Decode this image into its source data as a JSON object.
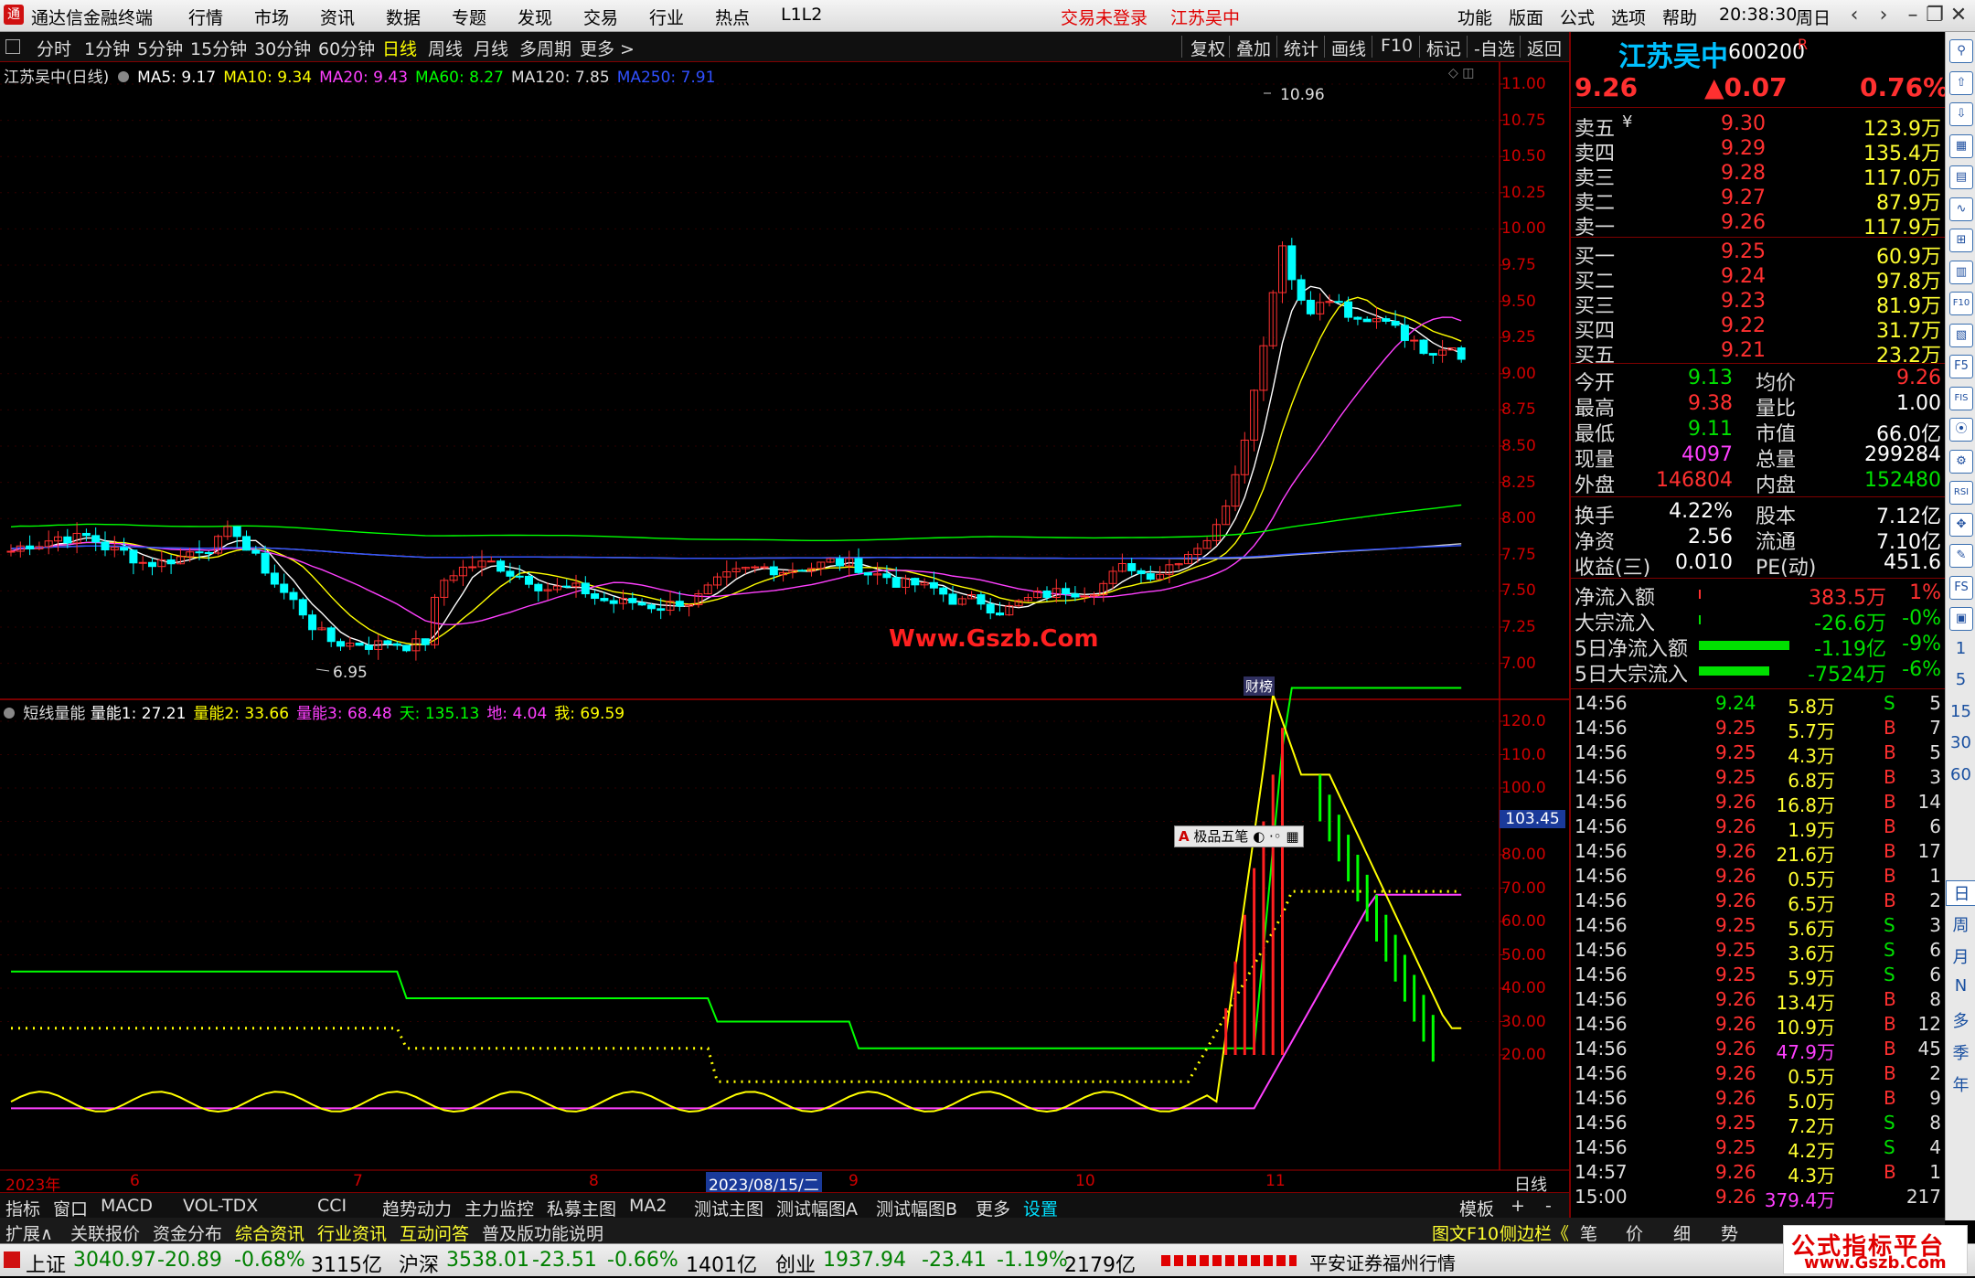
{
  "app": {
    "title": "通达信金融终端",
    "menu": [
      "行情",
      "市场",
      "资讯",
      "数据",
      "专题",
      "发现",
      "交易",
      "行业",
      "热点",
      "L1L2"
    ],
    "login_status": "交易未登录",
    "stock_name_header": "江苏吴中",
    "right_menu": [
      "功能",
      "版面",
      "公式",
      "选项",
      "帮助"
    ],
    "clock": "20:38:30",
    "weekday": "周日"
  },
  "toolbar": {
    "periods": [
      "分时",
      "1分钟",
      "5分钟",
      "15分钟",
      "30分钟",
      "60分钟",
      "日线",
      "周线",
      "月线",
      "多周期",
      "更多 >"
    ],
    "selected": "日线",
    "tools": [
      "复权",
      "叠加",
      "统计",
      "画线",
      "F10",
      "标记",
      "-自选",
      "返回"
    ]
  },
  "main_chart": {
    "title": "江苏吴中(日线)",
    "ma": [
      {
        "label": "MA5: 9.17",
        "color": "#ffffff"
      },
      {
        "label": "MA10: 9.34",
        "color": "#ffff00"
      },
      {
        "label": "MA20: 9.43",
        "color": "#ff40ff"
      },
      {
        "label": "MA60: 8.27",
        "color": "#00ff00"
      },
      {
        "label": "MA120: 7.85",
        "color": "#dddddd"
      },
      {
        "label": "MA250: 7.91",
        "color": "#3050ff"
      }
    ],
    "high_label": "10.96",
    "low_label": "6.95",
    "watermark": "Www.Gszb.Com",
    "caibang": "财榜",
    "y_ticks": [
      "11.00",
      "10.75",
      "10.50",
      "10.25",
      "10.00",
      "9.75",
      "9.50",
      "9.25",
      "9.00",
      "8.75",
      "8.50",
      "8.25",
      "8.00",
      "7.75",
      "7.50",
      "7.25",
      "7.00"
    ]
  },
  "indicator": {
    "name": "短线量能",
    "values": [
      {
        "label": "量能1: 27.21",
        "color": "#ffffff"
      },
      {
        "label": "量能2: 33.66",
        "color": "#ffff00"
      },
      {
        "label": "量能3: 68.48",
        "color": "#ff40ff"
      },
      {
        "label": "天: 135.13",
        "color": "#00ff00"
      },
      {
        "label": "地: 4.04",
        "color": "#ff40ff"
      },
      {
        "label": "我: 69.59",
        "color": "#ffff00"
      }
    ],
    "y_ticks": [
      "120.0",
      "110.0",
      "100.0",
      "90.00",
      "80.00",
      "70.00",
      "60.00",
      "50.00",
      "40.00",
      "30.00",
      "20.00"
    ],
    "current_value": "103.45",
    "popup": "极品五笔"
  },
  "x_axis": {
    "labels": [
      "2023年",
      "6",
      "7",
      "8",
      "2023/08/15/二",
      "9",
      "10",
      "11"
    ],
    "period": "日线"
  },
  "tabs_row1": [
    "指标",
    "窗口",
    "MACD",
    "VOL-TDX",
    "CCI",
    "趋势动力",
    "主力监控",
    "私募主图",
    "MA2",
    "测试主图",
    "测试幅图A",
    "测试幅图B",
    "更多",
    "设置"
  ],
  "tabs_row1_right": [
    "模板",
    "+",
    "-"
  ],
  "tabs_row2": [
    "扩展∧",
    "关联报价",
    "资金分布",
    "综合资讯",
    "行业资讯",
    "互动问答",
    "普及版功能说明"
  ],
  "right_panel": {
    "name": "江苏吴中",
    "code": "600200",
    "r_mark": "R",
    "price": "9.26",
    "change": "▲0.07",
    "change_pct": "0.76%",
    "asks": [
      {
        "label": "卖五",
        "price": "9.30",
        "vol": "123.9万"
      },
      {
        "label": "卖四",
        "price": "9.29",
        "vol": "135.4万"
      },
      {
        "label": "卖三",
        "price": "9.28",
        "vol": "117.0万"
      },
      {
        "label": "卖二",
        "price": "9.27",
        "vol": "87.9万"
      },
      {
        "label": "卖一",
        "price": "9.26",
        "vol": "117.9万"
      }
    ],
    "ask_mark": "¥",
    "bids": [
      {
        "label": "买一",
        "price": "9.25",
        "vol": "60.9万"
      },
      {
        "label": "买二",
        "price": "9.24",
        "vol": "97.8万"
      },
      {
        "label": "买三",
        "price": "9.23",
        "vol": "81.9万"
      },
      {
        "label": "买四",
        "price": "9.22",
        "vol": "31.7万"
      },
      {
        "label": "买五",
        "price": "9.21",
        "vol": "23.2万"
      }
    ],
    "stats": [
      {
        "l1": "今开",
        "v1": "9.13",
        "c1": "grn",
        "l2": "均价",
        "v2": "9.26",
        "c2": "red"
      },
      {
        "l1": "最高",
        "v1": "9.38",
        "c1": "red",
        "l2": "量比",
        "v2": "1.00",
        "c2": "wht"
      },
      {
        "l1": "最低",
        "v1": "9.11",
        "c1": "grn",
        "l2": "市值",
        "v2": "66.0亿",
        "c2": "wht"
      },
      {
        "l1": "现量",
        "v1": "4097",
        "c1": "mag",
        "l2": "总量",
        "v2": "299284",
        "c2": "wht"
      },
      {
        "l1": "外盘",
        "v1": "146804",
        "c1": "red",
        "l2": "内盘",
        "v2": "152480",
        "c2": "grn"
      }
    ],
    "stats2": [
      {
        "l1": "换手",
        "v1": "4.22%",
        "l2": "股本",
        "v2": "7.12亿"
      },
      {
        "l1": "净资",
        "v1": "2.56",
        "l2": "流通",
        "v2": "7.10亿"
      },
      {
        "l1": "收益(三)",
        "v1": "0.010",
        "l2": "PE(动)",
        "v2": "451.6"
      }
    ],
    "flows": [
      {
        "label": "净流入额",
        "value": "383.5万",
        "pct": "1%",
        "color": "red",
        "bar": 0.0
      },
      {
        "label": "大宗流入",
        "value": "-26.6万",
        "pct": "-0%",
        "color": "grn",
        "bar": 0.0
      },
      {
        "label": "5日净流入额",
        "value": "-1.19亿",
        "pct": "-9%",
        "color": "grn",
        "bar": 0.9
      },
      {
        "label": "5日大宗流入",
        "value": "-7524万",
        "pct": "-6%",
        "color": "grn",
        "bar": 0.7
      }
    ],
    "ticks": [
      {
        "t": "14:56",
        "p": "9.24",
        "v": "5.8万",
        "bs": "S",
        "n": "5"
      },
      {
        "t": "14:56",
        "p": "9.25",
        "v": "5.7万",
        "bs": "B",
        "n": "7"
      },
      {
        "t": "14:56",
        "p": "9.25",
        "v": "4.3万",
        "bs": "B",
        "n": "5"
      },
      {
        "t": "14:56",
        "p": "9.25",
        "v": "6.8万",
        "bs": "B",
        "n": "3"
      },
      {
        "t": "14:56",
        "p": "9.26",
        "v": "16.8万",
        "bs": "B",
        "n": "14"
      },
      {
        "t": "14:56",
        "p": "9.26",
        "v": "1.9万",
        "bs": "B",
        "n": "6"
      },
      {
        "t": "14:56",
        "p": "9.26",
        "v": "21.6万",
        "bs": "B",
        "n": "17"
      },
      {
        "t": "14:56",
        "p": "9.26",
        "v": "0.5万",
        "bs": "B",
        "n": "1"
      },
      {
        "t": "14:56",
        "p": "9.26",
        "v": "6.5万",
        "bs": "B",
        "n": "2"
      },
      {
        "t": "14:56",
        "p": "9.25",
        "v": "5.6万",
        "bs": "S",
        "n": "3"
      },
      {
        "t": "14:56",
        "p": "9.25",
        "v": "3.6万",
        "bs": "S",
        "n": "6"
      },
      {
        "t": "14:56",
        "p": "9.25",
        "v": "5.9万",
        "bs": "S",
        "n": "6"
      },
      {
        "t": "14:56",
        "p": "9.26",
        "v": "13.4万",
        "bs": "B",
        "n": "8"
      },
      {
        "t": "14:56",
        "p": "9.26",
        "v": "10.9万",
        "bs": "B",
        "n": "12"
      },
      {
        "t": "14:56",
        "p": "9.26",
        "v": "47.9万",
        "bs": "B",
        "n": "45"
      },
      {
        "t": "14:56",
        "p": "9.26",
        "v": "0.5万",
        "bs": "B",
        "n": "2"
      },
      {
        "t": "14:56",
        "p": "9.26",
        "v": "5.0万",
        "bs": "B",
        "n": "9"
      },
      {
        "t": "14:56",
        "p": "9.25",
        "v": "7.2万",
        "bs": "S",
        "n": "8"
      },
      {
        "t": "14:56",
        "p": "9.25",
        "v": "4.2万",
        "bs": "S",
        "n": "4"
      },
      {
        "t": "14:57",
        "p": "9.26",
        "v": "4.3万",
        "bs": "B",
        "n": "1"
      },
      {
        "t": "15:00",
        "p": "9.26",
        "v": "379.4万",
        "bs": "",
        "n": "217"
      }
    ],
    "bottom_tabs": [
      "笔",
      "价",
      "细",
      "势"
    ],
    "f10_link": "图文F10",
    "side_link": "侧边栏《"
  },
  "status_bar": {
    "indices": [
      {
        "name": "上证",
        "val": "3040.97",
        "chg": "-20.89",
        "pct": "-0.68%",
        "amt": "3115亿"
      },
      {
        "name": "沪深",
        "val": "3538.01",
        "chg": "-23.51",
        "pct": "-0.66%",
        "amt": "1401亿"
      },
      {
        "name": "创业",
        "val": "1937.94",
        "chg": "-23.41",
        "pct": "-1.19%",
        "amt": "2179亿"
      }
    ],
    "broker": "平安证券福州行情",
    "brand": "公式指标平台",
    "brand_url": "www.Gszb.Com"
  },
  "side_icons": [
    "⚲",
    "⇧",
    "⇩",
    "▦",
    "▤",
    "∿",
    "⊞",
    "▥",
    "F10",
    "▧",
    "F5",
    "FIS",
    "⦿",
    "⚙",
    "RSI",
    "✥",
    "✎",
    "FS",
    "▣",
    "1",
    "5",
    "15",
    "30",
    "60"
  ],
  "side_texts": [
    "日",
    "周",
    "月",
    "N",
    "多",
    "季",
    "年"
  ]
}
